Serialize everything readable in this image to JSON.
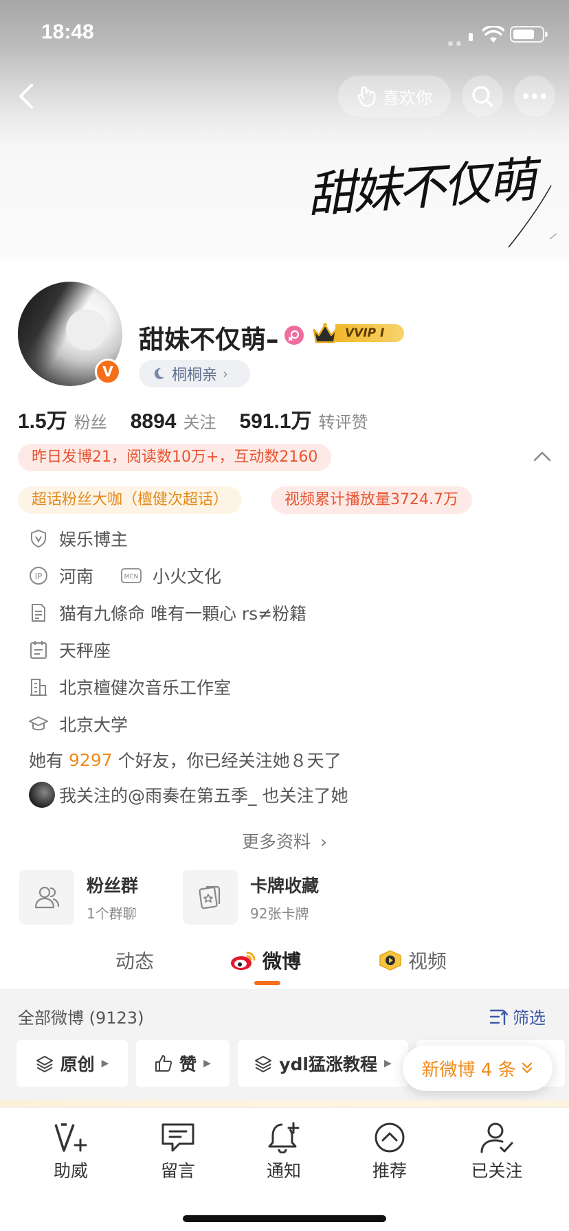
{
  "status_bar": {
    "time": "18:48"
  },
  "header": {
    "like_button": "喜欢你",
    "banner_text": "甜妹不仅萌"
  },
  "profile": {
    "name": "甜妹不仅萌–",
    "vip_label": "VVIP Ⅰ",
    "verified_mark": "V",
    "tag": "桐桐亲",
    "stats": [
      {
        "value": "1.5万",
        "label": "粉丝"
      },
      {
        "value": "8894",
        "label": "关注"
      },
      {
        "value": "591.1万",
        "label": "转评赞"
      }
    ],
    "highlights": {
      "yesterday": "昨日发博21，阅读数10万+，互动数2160",
      "supertopic": "超话粉丝大咖（檀健次超话）",
      "video_plays": "视频累计播放量3724.7万"
    },
    "info": {
      "category": "娱乐博主",
      "ip_location": "河南",
      "mcn": "小火文化",
      "bio": "猫有九條命 唯有一顆心 rs≠粉籍",
      "zodiac": "天秤座",
      "company": "北京檀健次音乐工作室",
      "school": "北京大学"
    },
    "friends": {
      "prefix": "她有",
      "count": "9297",
      "suffix": "个好友，你已经关注她８天了"
    },
    "mutual": "我关注的@雨奏在第五季_ 也关注了她",
    "more_info": "更多资料"
  },
  "cards": [
    {
      "title": "粉丝群",
      "subtitle": "1个群聊"
    },
    {
      "title": "卡牌收藏",
      "subtitle": "92张卡牌"
    }
  ],
  "tabs": [
    {
      "label": "动态"
    },
    {
      "label": "微博"
    },
    {
      "label": "视频"
    }
  ],
  "feed": {
    "all_count": "全部微博 (9123)",
    "filter_label": "筛选",
    "chips": [
      "原创",
      "赞",
      "ydl猛涨教程"
    ],
    "new_toast": "新微博 4 条"
  },
  "bottom_nav": [
    {
      "label": "助威"
    },
    {
      "label": "留言"
    },
    {
      "label": "通知"
    },
    {
      "label": "推荐"
    },
    {
      "label": "已关注"
    }
  ]
}
